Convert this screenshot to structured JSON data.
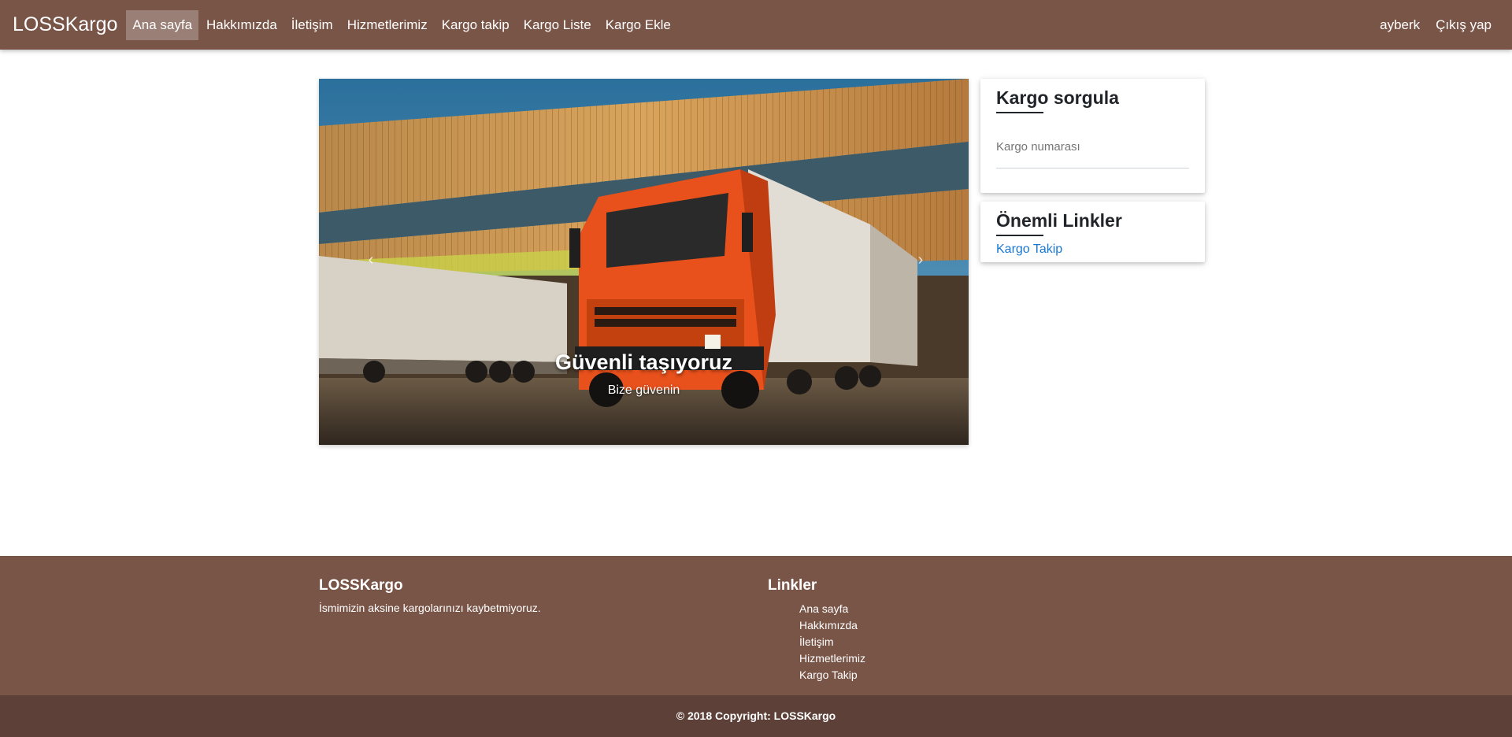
{
  "navbar": {
    "brand": "LOSSKargo",
    "items": [
      {
        "label": "Ana sayfa",
        "active": true
      },
      {
        "label": "Hakkımızda"
      },
      {
        "label": "İletişim"
      },
      {
        "label": "Hizmetlerimiz"
      },
      {
        "label": "Kargo takip"
      },
      {
        "label": "Kargo Liste"
      },
      {
        "label": "Kargo Ekle"
      }
    ],
    "right_items": [
      {
        "label": "ayberk"
      },
      {
        "label": "Çıkış yap"
      }
    ],
    "accent_color": "#795548"
  },
  "hero": {
    "title": "Güvenli taşıyoruz",
    "subtitle": "Bize güvenin",
    "prev_icon": "chevron-left-icon",
    "next_icon": "chevron-right-icon"
  },
  "sidebar": {
    "search_card": {
      "title": "Kargo sorgula",
      "input_placeholder": "Kargo numarası"
    },
    "links_card": {
      "title": "Önemli Linkler",
      "links": [
        {
          "label": "Kargo Takip"
        }
      ]
    }
  },
  "footer": {
    "brand": "LOSSKargo",
    "description": "İsmimizin aksine kargolarınızı kaybetmiyoruz.",
    "links_title": "Linkler",
    "links": [
      {
        "label": "Ana sayfa"
      },
      {
        "label": "Hakkımızda"
      },
      {
        "label": "İletişim"
      },
      {
        "label": "Hizmetlerimiz"
      },
      {
        "label": "Kargo Takip"
      }
    ],
    "copyright": "© 2018 Copyright: LOSSKargo",
    "color": "#795548",
    "copyright_color": "#5d4037"
  }
}
